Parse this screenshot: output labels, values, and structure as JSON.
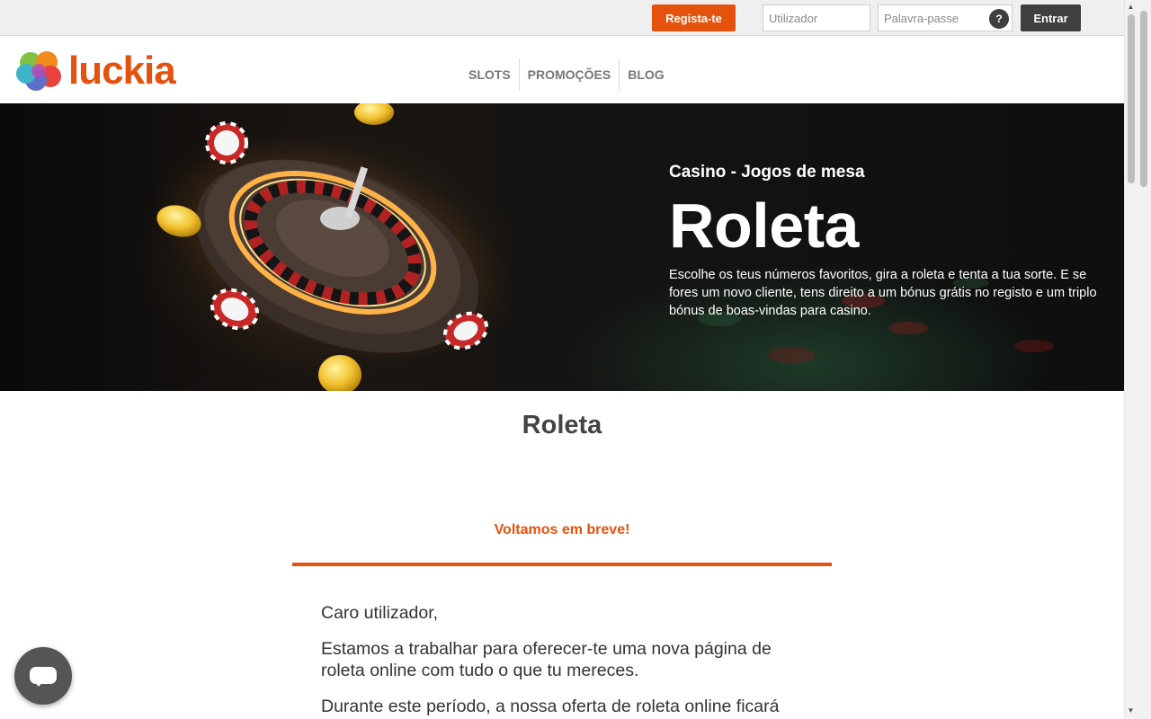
{
  "topbar": {
    "register_label": "Regista-te",
    "username_placeholder": "Utilizador",
    "password_placeholder": "Palavra-passe",
    "help_label": "?",
    "login_label": "Entrar"
  },
  "header": {
    "logo_text": "luckia",
    "nav": [
      {
        "label": "SLOTS"
      },
      {
        "label": "PROMOÇÕES"
      },
      {
        "label": "BLOG"
      }
    ]
  },
  "hero": {
    "subtitle": "Casino - Jogos de mesa",
    "title": "Roleta",
    "description": "Escolhe os teus números favoritos, gira a roleta e tenta a tua sorte. E se fores um novo cliente, tens direito a um bónus grátis no registo e um triplo bónus de boas-vindas para casino."
  },
  "main": {
    "page_title": "Roleta",
    "notice_title": "Voltamos em breve!",
    "paragraphs": [
      "Caro utilizador,",
      "Estamos a trabalhar para oferecer-te uma nova página de roleta online com tudo o que tu mereces.",
      "Durante este período, a nossa oferta de roleta online ficará"
    ]
  },
  "colors": {
    "brand_orange": "#e4520d",
    "dark_button": "#3f3f3f"
  },
  "icons": {
    "help": "question-mark-icon",
    "chat": "chat-bubble-icon",
    "logo": "clover-logo-icon"
  }
}
